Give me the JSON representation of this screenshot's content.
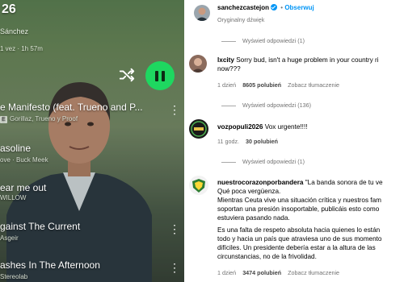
{
  "player": {
    "time_partial": "26",
    "artist_partial": "Sánchez",
    "meta_partial": "1 vez · 1h 57m",
    "tracks": [
      {
        "title": "e Manifesto (feat. Trueno and P...",
        "sub": "Gorillaz, Trueno y Proof",
        "explicit": "E"
      },
      {
        "title": "asoline",
        "sub": "ove · Buck Meek",
        "explicit": ""
      },
      {
        "title": "ear me out",
        "sub": "WILLOW",
        "explicit": ""
      },
      {
        "title": "gainst The Current",
        "sub": "Asgeir",
        "explicit": ""
      },
      {
        "title": "ashes In The Afternoon",
        "sub": "Stereolab",
        "explicit": ""
      }
    ],
    "accent_color": "#1ed760"
  },
  "post": {
    "username": "sanchezcastejon",
    "follow_label": "Obserwuj",
    "separator": "•",
    "audio": "Oryginalny dźwięk"
  },
  "comments": [
    {
      "view_replies": "Wyświetl odpowiedzi (1)"
    },
    {
      "username": "lxcity",
      "text_line1": "Sorry bud, isn't a huge problem in your country ri",
      "text_line2": "now???",
      "time": "1 dzień",
      "likes": "8605 polubień",
      "translate": "Zobacz tłumaczenie",
      "view_replies": "Wyświetl odpowiedzi (136)"
    },
    {
      "username": "vozpopuli2026",
      "text": "Vox urgente!!!!",
      "time": "11 godz.",
      "likes": "30 polubień",
      "view_replies": "Wyświetl odpowiedzi (1)"
    },
    {
      "username": "nuestrocorazonporbandera",
      "lines": [
        "\"La banda sonora de tu ve",
        "Qué poca vergüenza.",
        "Mientras Ceuta vive una situación crítica y nuestros fam",
        "soportan una presión insoportable, publicáis esto como",
        "estuviera pasando nada.",
        "Es una falta de respeto absoluta hacia quienes lo están",
        "todo y hacia un país que atraviesa uno de sus momento",
        "difíciles. Un presidente debería estar a la altura de las",
        "circunstancias, no de la frivolidad."
      ],
      "time": "1 dzień",
      "likes": "3474 polubień",
      "translate": "Zobacz tłumaczenie"
    }
  ],
  "colors": {
    "link_blue": "#0095f6",
    "muted_gray": "#737373"
  }
}
